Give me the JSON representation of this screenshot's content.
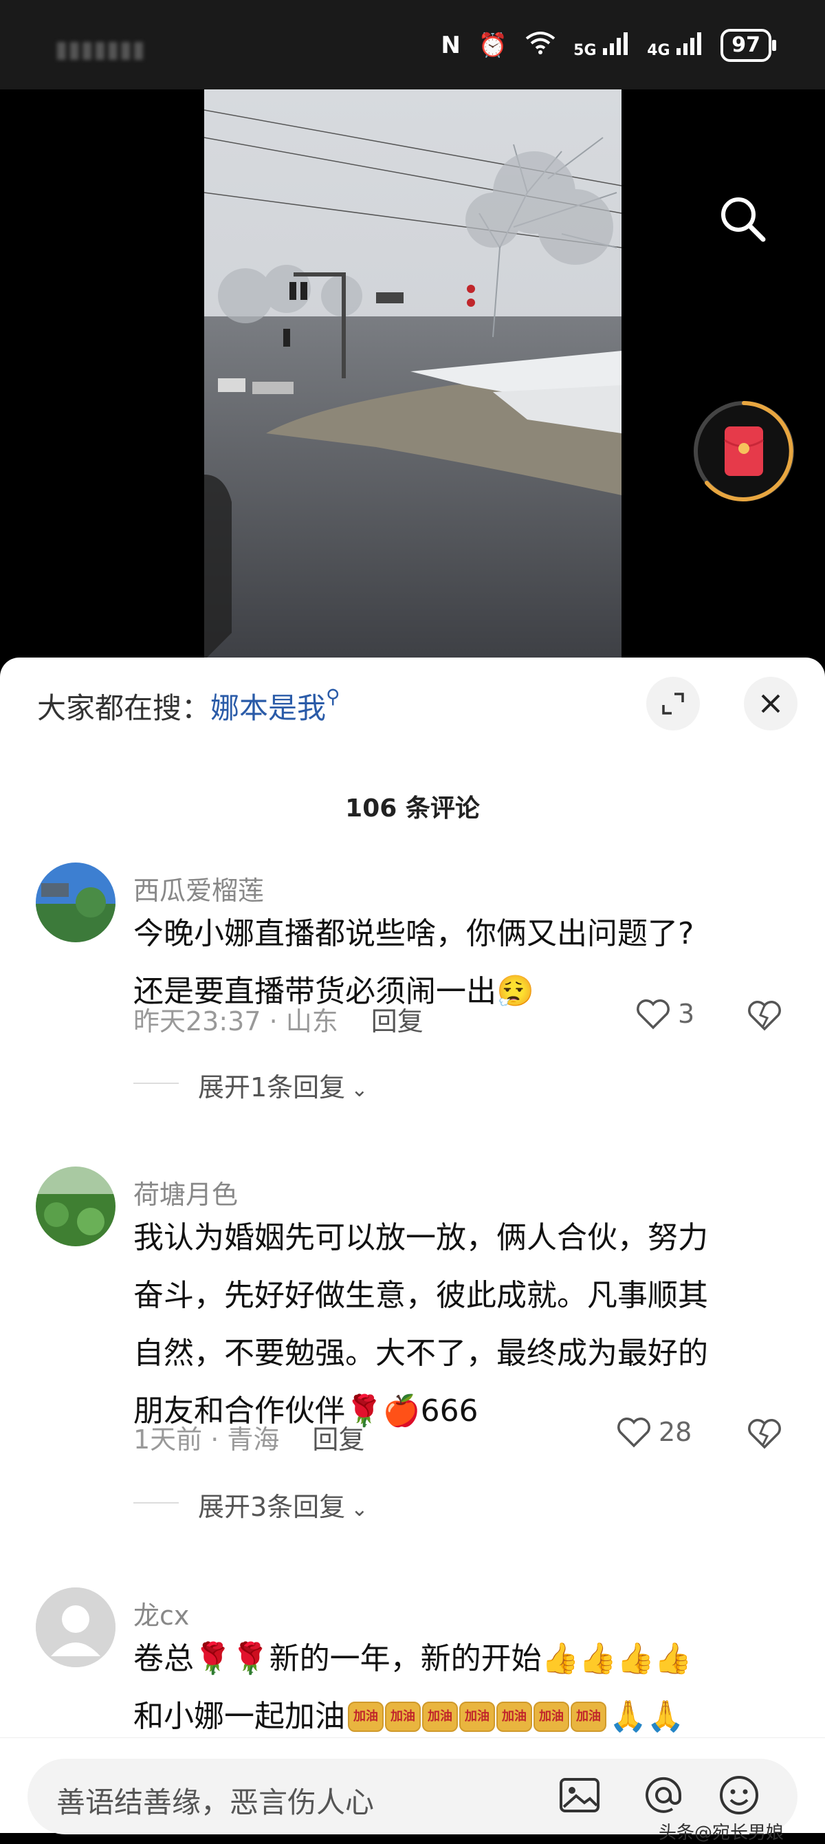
{
  "status_bar": {
    "network_labels": [
      "5G",
      "4G"
    ],
    "battery": "97"
  },
  "search": {
    "label": "大家都在搜：",
    "keyword": "娜本是我"
  },
  "comments_header": {
    "count_label": "106 条评论"
  },
  "comments": [
    {
      "username": "西瓜爱榴莲",
      "text_lines": [
        "今晚小娜直播都说些啥，你俩又出问题了?",
        "还是要直播带货必须闹一出😮‍💨"
      ],
      "time_location": "昨天23:37 · 山东",
      "reply_label": "回复",
      "likes": "3",
      "expand_label": "展开1条回复"
    },
    {
      "username": "荷塘月色",
      "text_lines": [
        "我认为婚姻先可以放一放，俩人合伙，努力",
        "奋斗，先好好做生意，彼此成就。凡事顺其",
        "自然，不要勉强。大不了，最终成为最好的",
        "朋友和合作伙伴🌹🍎666"
      ],
      "time_location": "1天前 · 青海",
      "reply_label": "回复",
      "likes": "28",
      "expand_label": "展开3条回复"
    },
    {
      "username": "龙cx",
      "text_lines": [
        "卷总🌹🌹新的一年，新的开始👍👍👍👍",
        "和小娜一起加油"
      ]
    }
  ],
  "stickers": {
    "jiayou_label": "加油",
    "count": 7
  },
  "input": {
    "placeholder": "善语结善缘，恶言伤人心"
  },
  "watermark": "头条@宛长男娘",
  "colors": {
    "accent_link": "#2a5ba8",
    "red_packet": "#e63a4a",
    "gold_ring": "#e8a640"
  }
}
